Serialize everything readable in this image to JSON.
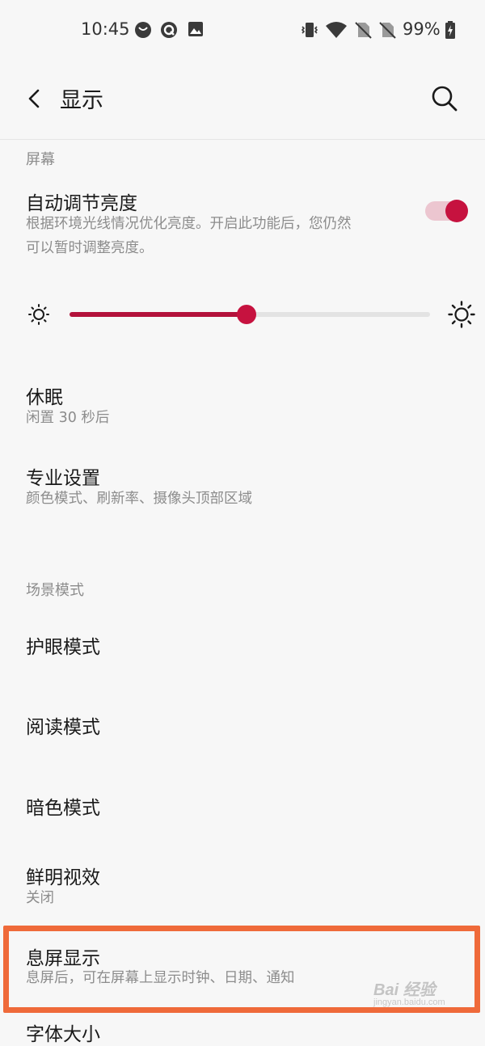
{
  "status_bar": {
    "time": "10:45",
    "battery": "99%",
    "icons": [
      "smile-notification-icon",
      "q-app-icon",
      "gallery-icon",
      "vibrate-icon",
      "wifi-icon",
      "no-sim-icon",
      "no-sim-icon",
      "battery-charging-icon"
    ]
  },
  "app_bar": {
    "back_icon": "back-arrow-icon",
    "title": "显示",
    "search_icon": "search-icon"
  },
  "sections": {
    "screen": "屏幕",
    "scene": "场景模式"
  },
  "auto_brightness": {
    "title": "自动调节亮度",
    "summary_line1": "根据环境光线情况优化亮度。开启此功能后，您仍然",
    "summary_line2": "可以暂时调整亮度。",
    "enabled": true
  },
  "brightness_slider": {
    "level": 0.49,
    "low_icon": "brightness-low-icon",
    "high_icon": "brightness-high-icon"
  },
  "items": {
    "sleep": {
      "title": "休眠",
      "summary": "闲置 30 秒后"
    },
    "advanced": {
      "title": "专业设置",
      "summary": "颜色模式、刷新率、摄像头顶部区域"
    },
    "eye_care": {
      "title": "护眼模式"
    },
    "reading": {
      "title": "阅读模式"
    },
    "dark": {
      "title": "暗色模式"
    },
    "vivid": {
      "title": "鲜明视效",
      "summary": "关闭"
    },
    "ambient": {
      "title": "息屏显示",
      "summary": "息屏后，可在屏幕上显示时钟、日期、通知"
    },
    "font_size": {
      "title": "字体大小"
    }
  },
  "watermark": {
    "brand": "Bai 经验",
    "url": "jingyan.baidu.com"
  },
  "colors": {
    "accent": "#c6123f",
    "highlight": "#ef6a3a",
    "background": "#f7f7f7"
  }
}
